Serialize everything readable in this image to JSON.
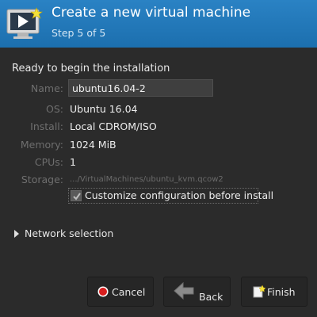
{
  "header": {
    "title": "Create a new virtual machine",
    "subtitle": "Step 5 of 5",
    "icon": "monitor-play-icon"
  },
  "summary": {
    "heading": "Ready to begin the installation",
    "name_label": "Name:",
    "name_value": "ubuntu16.04-2",
    "os_label": "OS:",
    "os_value": "Ubuntu 16.04",
    "install_label": "Install:",
    "install_value": "Local CDROM/ISO",
    "memory_label": "Memory:",
    "memory_value": "1024 MiB",
    "cpus_label": "CPUs:",
    "cpus_value": "1",
    "storage_label": "Storage:",
    "storage_value": ".../VirtualMachines/ubuntu_kvm.qcow2",
    "customize_label": "Customize configuration before install",
    "customize_checked": true
  },
  "network": {
    "label": "Network selection"
  },
  "buttons": {
    "cancel": "Cancel",
    "back": "Back",
    "finish": "Finish"
  },
  "colors": {
    "header": "#1f77b4",
    "background": "#2b2b2b",
    "cancel_icon": "#d81e1e"
  }
}
